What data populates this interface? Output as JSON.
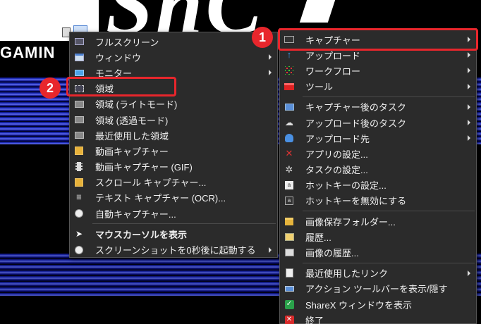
{
  "background": {
    "big_text": "ShC",
    "logo_text": "GAMIN"
  },
  "badges": {
    "badge1": "1",
    "badge2": "2"
  },
  "left_menu": {
    "items": [
      {
        "label": "フルスクリーン",
        "icon": "screen-icon"
      },
      {
        "label": "ウィンドウ",
        "icon": "window-icon",
        "submenu": true
      },
      {
        "label": "モニター",
        "icon": "monitor-icon",
        "submenu": true
      },
      {
        "label": "領域",
        "icon": "region-icon"
      },
      {
        "label": "領域 (ライトモード)",
        "icon": "region-light-icon"
      },
      {
        "label": "領域 (透過モード)",
        "icon": "region-transparent-icon"
      },
      {
        "label": "最近使用した領域",
        "icon": "recent-region-icon"
      },
      {
        "label": "動画キャプチャー",
        "icon": "video-icon"
      },
      {
        "label": "動画キャプチャー (GIF)",
        "icon": "gif-icon"
      },
      {
        "label": "スクロール キャプチャー...",
        "icon": "scroll-icon"
      },
      {
        "label": "テキスト キャプチャー (OCR)...",
        "icon": "ocr-icon"
      },
      {
        "label": "自動キャプチャー...",
        "icon": "clock-icon"
      },
      {
        "label": "マウスカーソルを表示",
        "icon": "cursor-icon"
      },
      {
        "label": "スクリーンショットを0秒後に起動する",
        "icon": "timer-icon",
        "submenu": true
      }
    ]
  },
  "right_menu": {
    "items": [
      {
        "label": "キャプチャー",
        "icon": "capture-icon",
        "submenu": true
      },
      {
        "label": "アップロード",
        "icon": "upload-icon",
        "submenu": true
      },
      {
        "label": "ワークフロー",
        "icon": "workflow-icon",
        "submenu": true
      },
      {
        "label": "ツール",
        "icon": "tools-icon",
        "submenu": true
      },
      {
        "label": "キャプチャー後のタスク",
        "icon": "after-capture-icon",
        "submenu": true
      },
      {
        "label": "アップロード後のタスク",
        "icon": "after-upload-icon",
        "submenu": true
      },
      {
        "label": "アップロード先",
        "icon": "destination-icon",
        "submenu": true
      },
      {
        "label": "アプリの設定...",
        "icon": "app-settings-icon"
      },
      {
        "label": "タスクの設定...",
        "icon": "task-settings-icon"
      },
      {
        "label": "ホットキーの設定...",
        "icon": "hotkey-icon"
      },
      {
        "label": "ホットキーを無効にする",
        "icon": "hotkey-disable-icon"
      },
      {
        "label": "画像保存フォルダー...",
        "icon": "folder-icon"
      },
      {
        "label": "履歴...",
        "icon": "history-icon"
      },
      {
        "label": "画像の履歴...",
        "icon": "image-history-icon"
      },
      {
        "label": "最近使用したリンク",
        "icon": "recent-links-icon",
        "submenu": true
      },
      {
        "label": "アクション ツールバーを表示/隠す",
        "icon": "toolbar-icon"
      },
      {
        "label": "ShareX ウィンドウを表示",
        "icon": "check-icon"
      },
      {
        "label": "終了",
        "icon": "exit-icon"
      }
    ]
  },
  "colors": {
    "menu_bg": "#2b2b2b",
    "highlight": "#e8262c",
    "text": "#f0f0f0"
  }
}
